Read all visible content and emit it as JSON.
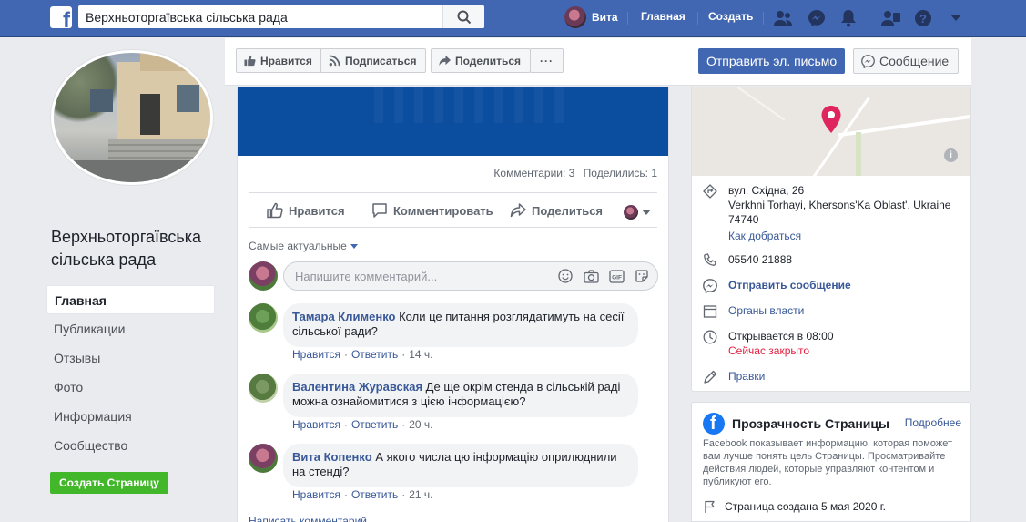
{
  "topbar": {
    "search_value": "Верхньоторгаївська сільська рада",
    "user_name": "Вита",
    "home_label": "Главная",
    "create_label": "Создать"
  },
  "page": {
    "name": "Верхньоторгаївська сільська рада"
  },
  "left_nav": {
    "items": [
      {
        "label": "Главная",
        "active": true
      },
      {
        "label": "Публикации"
      },
      {
        "label": "Отзывы"
      },
      {
        "label": "Фото"
      },
      {
        "label": "Информация"
      },
      {
        "label": "Сообщество"
      }
    ],
    "create_page_label": "Создать Страницу"
  },
  "action_bar": {
    "like_label": "Нравится",
    "follow_label": "Подписаться",
    "share_label": "Поделиться",
    "more_label": "···",
    "email_button": "Отправить эл. письмо",
    "message_button": "Сообщение"
  },
  "post": {
    "comments_count": "Комментарии: 3",
    "shares_count": "Поделились: 1",
    "like_label": "Нравится",
    "comment_label": "Комментировать",
    "share_label": "Поделиться",
    "sort_label": "Самые актуальные",
    "comment_placeholder": "Напишите комментарий...",
    "write_comment_label": "Написать комментарий",
    "comments": [
      {
        "author": "Тамара Клименко",
        "text": "Коли це питання розглядатимуть на сесії сільської ради?",
        "like": "Нравится",
        "reply": "Ответить",
        "time": "14 ч."
      },
      {
        "author": "Валентина Журавская",
        "text": "Де ще окрім стенда в сільській раді можна ознайомитися з цією інформацією?",
        "like": "Нравится",
        "reply": "Ответить",
        "time": "20 ч."
      },
      {
        "author": "Вита Копенко",
        "text": "А якого числа цю інформацію оприлюднили на стенді?",
        "like": "Нравится",
        "reply": "Ответить",
        "time": "21 ч."
      }
    ]
  },
  "info": {
    "address_line1": "вул. Східна, 26",
    "address_line2": "Verkhni Torhayi, Khersons'Ka Oblast', Ukraine",
    "address_line3": "74740",
    "directions": "Как добраться",
    "phone": "05540 21888",
    "send_message": "Отправить сообщение",
    "category": "Органы власти",
    "opens": "Открывается в 08:00",
    "closed": "Сейчас закрыто",
    "edits": "Правки"
  },
  "transparency": {
    "title": "Прозрачность Страницы",
    "more": "Подробнее",
    "description": "Facebook показывает информацию, которая поможет вам лучше понять цель Страницы. Просматривайте действия людей, которые управляют контентом и публикуют его.",
    "created": "Страница создана 5 мая 2020 г."
  },
  "colors": {
    "brand": "#4267b2",
    "link": "#385898",
    "green": "#42b72a",
    "closed_red": "#e41e3f",
    "pin_red": "#e0245e"
  },
  "icons": {
    "logo": "facebook-logo-icon",
    "search": "search-icon",
    "friends": "friends-icon",
    "messenger": "messenger-icon",
    "notifications": "bell-icon",
    "pages": "pages-icon",
    "help": "help-icon",
    "menu": "caret-down-icon"
  }
}
